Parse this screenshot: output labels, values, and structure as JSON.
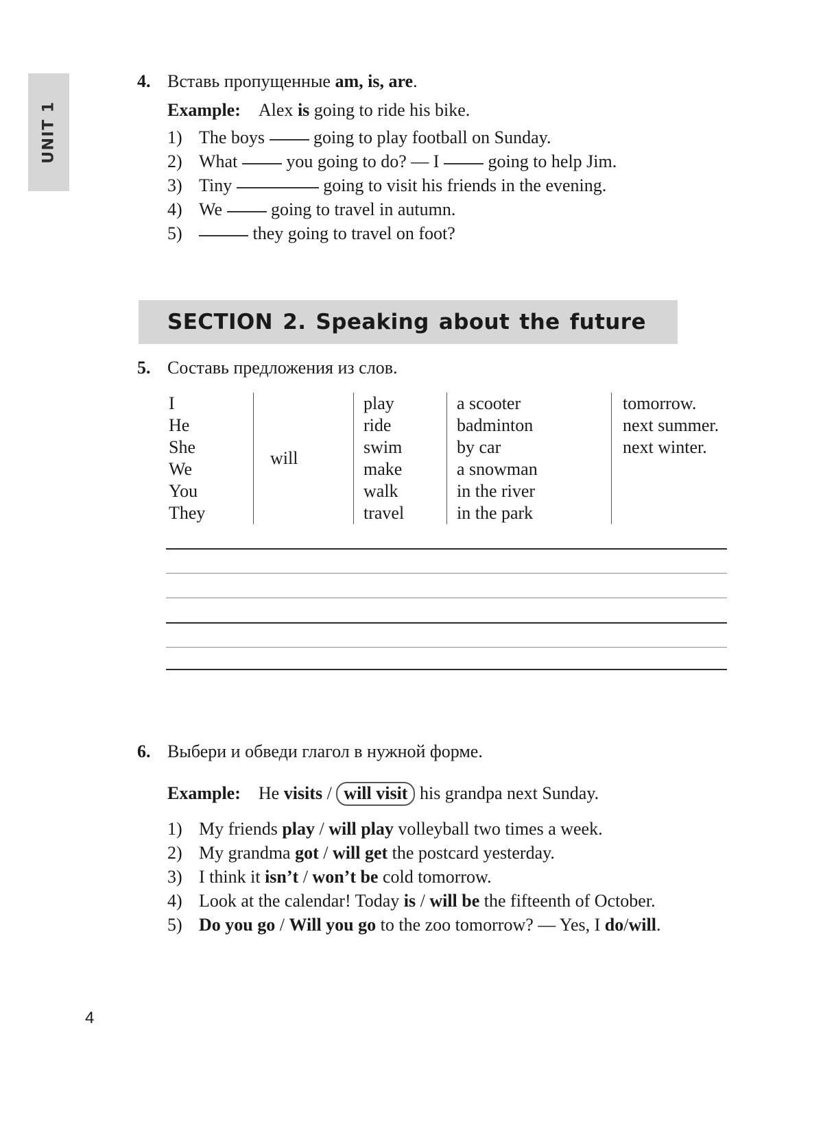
{
  "unit_tab": {
    "label": "UNIT 1"
  },
  "page_number": "4",
  "exercise4": {
    "number": "4.",
    "title_prefix": "Вставь пропущенные ",
    "title_bold": "am, is, are",
    "title_suffix": ".",
    "example_label": "Example:",
    "example_pre": "Alex ",
    "example_bold": "is",
    "example_post": " going to ride his bike.",
    "items": [
      {
        "marker": "1)",
        "pre": "The boys ",
        "blank": "s",
        "post": " going to play football on Sunday."
      },
      {
        "marker": "2)",
        "pre": "What ",
        "blank": "s",
        "mid": " you going to do? — I ",
        "blank2": "s",
        "post": " going to help Jim."
      },
      {
        "marker": "3)",
        "pre": "Tiny ",
        "blank": "l",
        "post": " going to visit his friends in the evening."
      },
      {
        "marker": "4)",
        "pre": "We ",
        "blank": "s",
        "post": " going to travel in autumn."
      },
      {
        "marker": "5)",
        "pre": "",
        "blank": "m",
        "post": " they going to travel on foot?"
      }
    ]
  },
  "section_banner": {
    "text": "SECTION 2. Speaking about the future"
  },
  "exercise5": {
    "number": "5.",
    "title": "Составь предложения из слов.",
    "table": {
      "subjects": [
        "I",
        "He",
        "She",
        "We",
        "You",
        "They"
      ],
      "modal": "will",
      "verbs": [
        "play",
        "ride",
        "swim",
        "make",
        "walk",
        "travel"
      ],
      "objects": [
        "a scooter",
        "badminton",
        "by car",
        "a snowman",
        "in the river",
        "in the park"
      ],
      "times": [
        "tomorrow.",
        "next summer.",
        "next winter."
      ]
    },
    "writing_lines": 6
  },
  "exercise6": {
    "number": "6.",
    "title": "Выбери и обведи глагол в нужной форме.",
    "example_label": "Example:",
    "example_pre": "He ",
    "example_option_a": "visits",
    "example_slash": " / ",
    "example_option_b": "will visit",
    "example_post": " his grandpa next Sunday.",
    "items": [
      {
        "marker": "1)",
        "pre": "My friends ",
        "option_a": "play",
        "slash": " / ",
        "option_b": "will play",
        "post": " volleyball two times a week."
      },
      {
        "marker": "2)",
        "pre": "My grandma ",
        "option_a": "got",
        "slash": " / ",
        "option_b": "will get",
        "post": " the postcard yesterday."
      },
      {
        "marker": "3)",
        "pre": "I think it ",
        "option_a": "isn’t",
        "slash": " / ",
        "option_b": "won’t be",
        "post": " cold tomorrow."
      },
      {
        "marker": "4)",
        "pre": "Look at the calendar! Today ",
        "option_a": "is",
        "slash": " / ",
        "option_b": "will be",
        "post": " the fifteenth of October."
      },
      {
        "marker": "5)",
        "pre": "",
        "option_a": "Do you go",
        "slash": " / ",
        "option_b": "Will you go",
        "post": " to the zoo tomorrow? — Yes, I ",
        "post_bold": "do",
        "post_slash": "/",
        "post_bold2": "will",
        "post_end": "."
      }
    ]
  }
}
